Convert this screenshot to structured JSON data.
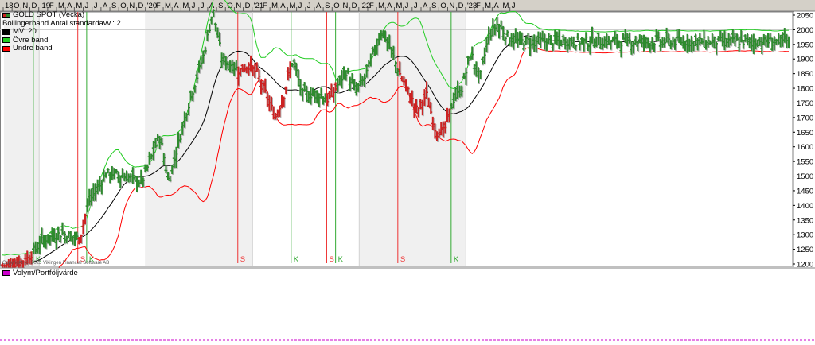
{
  "legend": {
    "instrument": "GOLD SPOT (Vecka)",
    "bollinger": "Bollingerband  Antal standardavv.: 2",
    "ma": "MV: 20",
    "upper": "Övre band",
    "lower": "Undre band",
    "volume": "Volym/Portföljvärde"
  },
  "copyright": "Copyright (c) 2023 Vikingen Financial Software AB",
  "colors": {
    "up_bar": "#2e8b2e",
    "down_bar": "#cc2222",
    "ma_line": "#000000",
    "upper_band": "#22cc22",
    "lower_band": "#ff0000",
    "buy_signal": "#33aa33",
    "sell_signal": "#ee3333",
    "volume_line": "#cc00cc",
    "instrument_swatch": "#2e8b2e"
  },
  "chart_data": {
    "type": "line",
    "title": "GOLD SPOT (Vecka)",
    "y_axis": {
      "ticks": [
        1200,
        1250,
        1300,
        1350,
        1400,
        1450,
        1500,
        1550,
        1600,
        1650,
        1700,
        1750,
        1800,
        1850,
        1900,
        1950,
        2000,
        2050
      ],
      "ylim": [
        1175,
        2100
      ],
      "side": "right"
    },
    "x_axis": {
      "labels": [
        "18",
        "O",
        "N",
        "D",
        "'19",
        "F",
        "M",
        "A",
        "M",
        "J",
        "J",
        "A",
        "S",
        "O",
        "N",
        "D",
        "'20",
        "F",
        "M",
        "A",
        "M",
        "J",
        "J",
        "A",
        "S",
        "O",
        "N",
        "D",
        "'21",
        "F",
        "M",
        "A",
        "M",
        "J",
        "J",
        "A",
        "S",
        "O",
        "N",
        "D",
        "'22",
        "F",
        "M",
        "A",
        "M",
        "J",
        "J",
        "A",
        "S",
        "O",
        "N",
        "D",
        "'23",
        "F",
        "M",
        "A",
        "M",
        "J"
      ],
      "range": [
        "2018-09",
        "2023-06"
      ]
    },
    "anchor_points": [
      {
        "date": "2018-09",
        "close": 1195
      },
      {
        "date": "2018-11",
        "close": 1215
      },
      {
        "date": "2019-01",
        "close": 1285
      },
      {
        "date": "2019-03",
        "close": 1305
      },
      {
        "date": "2019-05",
        "close": 1285
      },
      {
        "date": "2019-06",
        "close": 1410
      },
      {
        "date": "2019-08",
        "close": 1510
      },
      {
        "date": "2019-10",
        "close": 1500
      },
      {
        "date": "2019-12",
        "close": 1480
      },
      {
        "date": "2020-02",
        "close": 1640
      },
      {
        "date": "2020-03",
        "close": 1480
      },
      {
        "date": "2020-05",
        "close": 1720
      },
      {
        "date": "2020-07",
        "close": 1920
      },
      {
        "date": "2020-08",
        "close": 2070
      },
      {
        "date": "2020-09",
        "close": 1900
      },
      {
        "date": "2020-11",
        "close": 1860
      },
      {
        "date": "2020-12",
        "close": 1880
      },
      {
        "date": "2021-01",
        "close": 1850
      },
      {
        "date": "2021-03",
        "close": 1700
      },
      {
        "date": "2021-04",
        "close": 1780
      },
      {
        "date": "2021-05",
        "close": 1900
      },
      {
        "date": "2021-06",
        "close": 1780
      },
      {
        "date": "2021-08",
        "close": 1780
      },
      {
        "date": "2021-09",
        "close": 1760
      },
      {
        "date": "2021-11",
        "close": 1860
      },
      {
        "date": "2021-12",
        "close": 1790
      },
      {
        "date": "2022-01",
        "close": 1830
      },
      {
        "date": "2022-03",
        "close": 2000
      },
      {
        "date": "2022-04",
        "close": 1930
      },
      {
        "date": "2022-05",
        "close": 1850
      },
      {
        "date": "2022-07",
        "close": 1720
      },
      {
        "date": "2022-08",
        "close": 1780
      },
      {
        "date": "2022-09",
        "close": 1660
      },
      {
        "date": "2022-10",
        "close": 1650
      },
      {
        "date": "2022-11",
        "close": 1760
      },
      {
        "date": "2022-12",
        "close": 1800
      },
      {
        "date": "2023-01",
        "close": 1920
      },
      {
        "date": "2023-02",
        "close": 1830
      },
      {
        "date": "2023-03",
        "close": 1980
      },
      {
        "date": "2023-04",
        "close": 2020
      },
      {
        "date": "2023-05",
        "close": 1980
      },
      {
        "date": "2023-06",
        "close": 1960
      }
    ],
    "ma_period": 20,
    "std_dev": 2,
    "signals": [
      {
        "date": "2018-12",
        "type": "K"
      },
      {
        "date": "2019-05",
        "type": "S"
      },
      {
        "date": "2019-06",
        "type": "K"
      },
      {
        "date": "2020-11",
        "type": "S"
      },
      {
        "date": "2021-05",
        "type": "K"
      },
      {
        "date": "2021-09",
        "type": "S"
      },
      {
        "date": "2021-10",
        "type": "K"
      },
      {
        "date": "2022-05",
        "type": "S"
      },
      {
        "date": "2022-11",
        "type": "K"
      }
    ],
    "grid": true,
    "legend_position": "top-left"
  }
}
